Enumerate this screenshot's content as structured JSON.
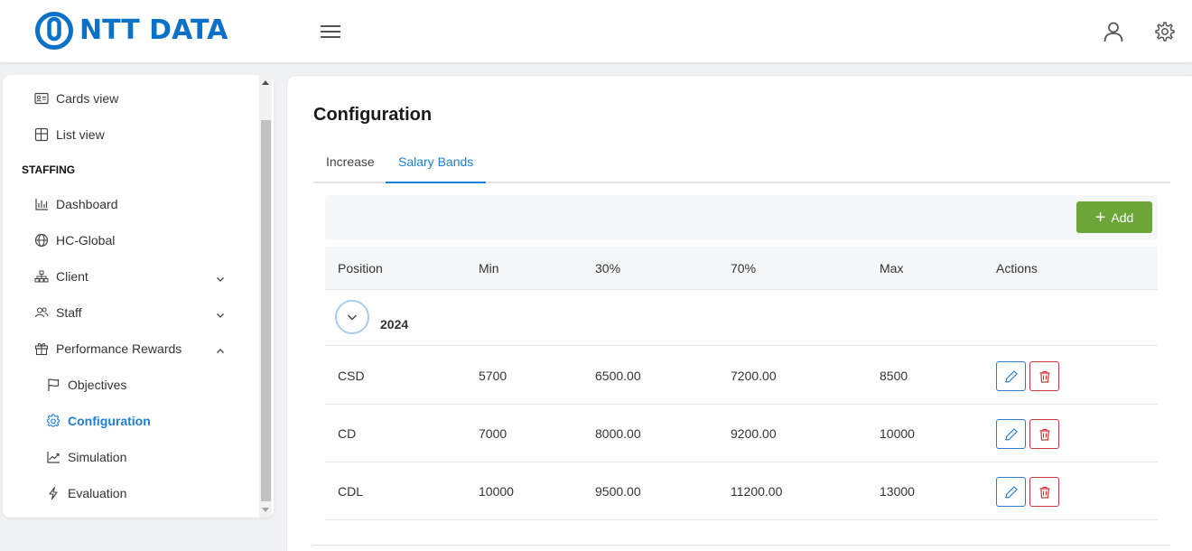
{
  "header": {
    "logo_text": "NTT DATA",
    "brand_color": "#0a71c8",
    "menu_icon": "hamburger-menu-icon",
    "user_icon": "user-icon",
    "settings_icon": "gear-icon"
  },
  "sidebar": {
    "top_items": [
      {
        "label": "Cards view",
        "icon": "id-card-icon"
      },
      {
        "label": "List view",
        "icon": "table-grid-icon"
      }
    ],
    "section_title": "STAFFING",
    "items": [
      {
        "label": "Dashboard",
        "icon": "bar-chart-icon"
      },
      {
        "label": "HC-Global",
        "icon": "globe-icon"
      },
      {
        "label": "Client",
        "icon": "org-chart-icon",
        "chevron": "down"
      },
      {
        "label": "Staff",
        "icon": "users-icon",
        "chevron": "down"
      },
      {
        "label": "Performance Rewards",
        "icon": "gift-icon",
        "chevron": "up"
      }
    ],
    "sub_items": [
      {
        "label": "Objectives",
        "icon": "flag-icon"
      },
      {
        "label": "Configuration",
        "icon": "gear-icon",
        "active": true
      },
      {
        "label": "Simulation",
        "icon": "trend-chart-icon"
      },
      {
        "label": "Evaluation",
        "icon": "lightning-icon"
      }
    ],
    "active_color": "#1c7fd8"
  },
  "main": {
    "title": "Configuration",
    "tabs": [
      {
        "label": "Increase",
        "active": false
      },
      {
        "label": "Salary Bands",
        "active": true
      }
    ],
    "add_button": "Add",
    "add_color": "#6ca639",
    "columns": [
      "Position",
      "Min",
      "30%",
      "70%",
      "Max",
      "Actions"
    ],
    "group": {
      "label": "2024",
      "expanded": true
    },
    "rows": [
      {
        "position": "CSD",
        "min": "5700",
        "p30": "6500.00",
        "p70": "7200.00",
        "max": "8500"
      },
      {
        "position": "CD",
        "min": "7000",
        "p30": "8000.00",
        "p70": "9200.00",
        "max": "10000"
      },
      {
        "position": "CDL",
        "min": "10000",
        "p30": "9500.00",
        "p70": "11200.00",
        "max": "13000"
      }
    ],
    "edit_color": "#2b7fc9",
    "delete_color": "#c93a3a"
  }
}
